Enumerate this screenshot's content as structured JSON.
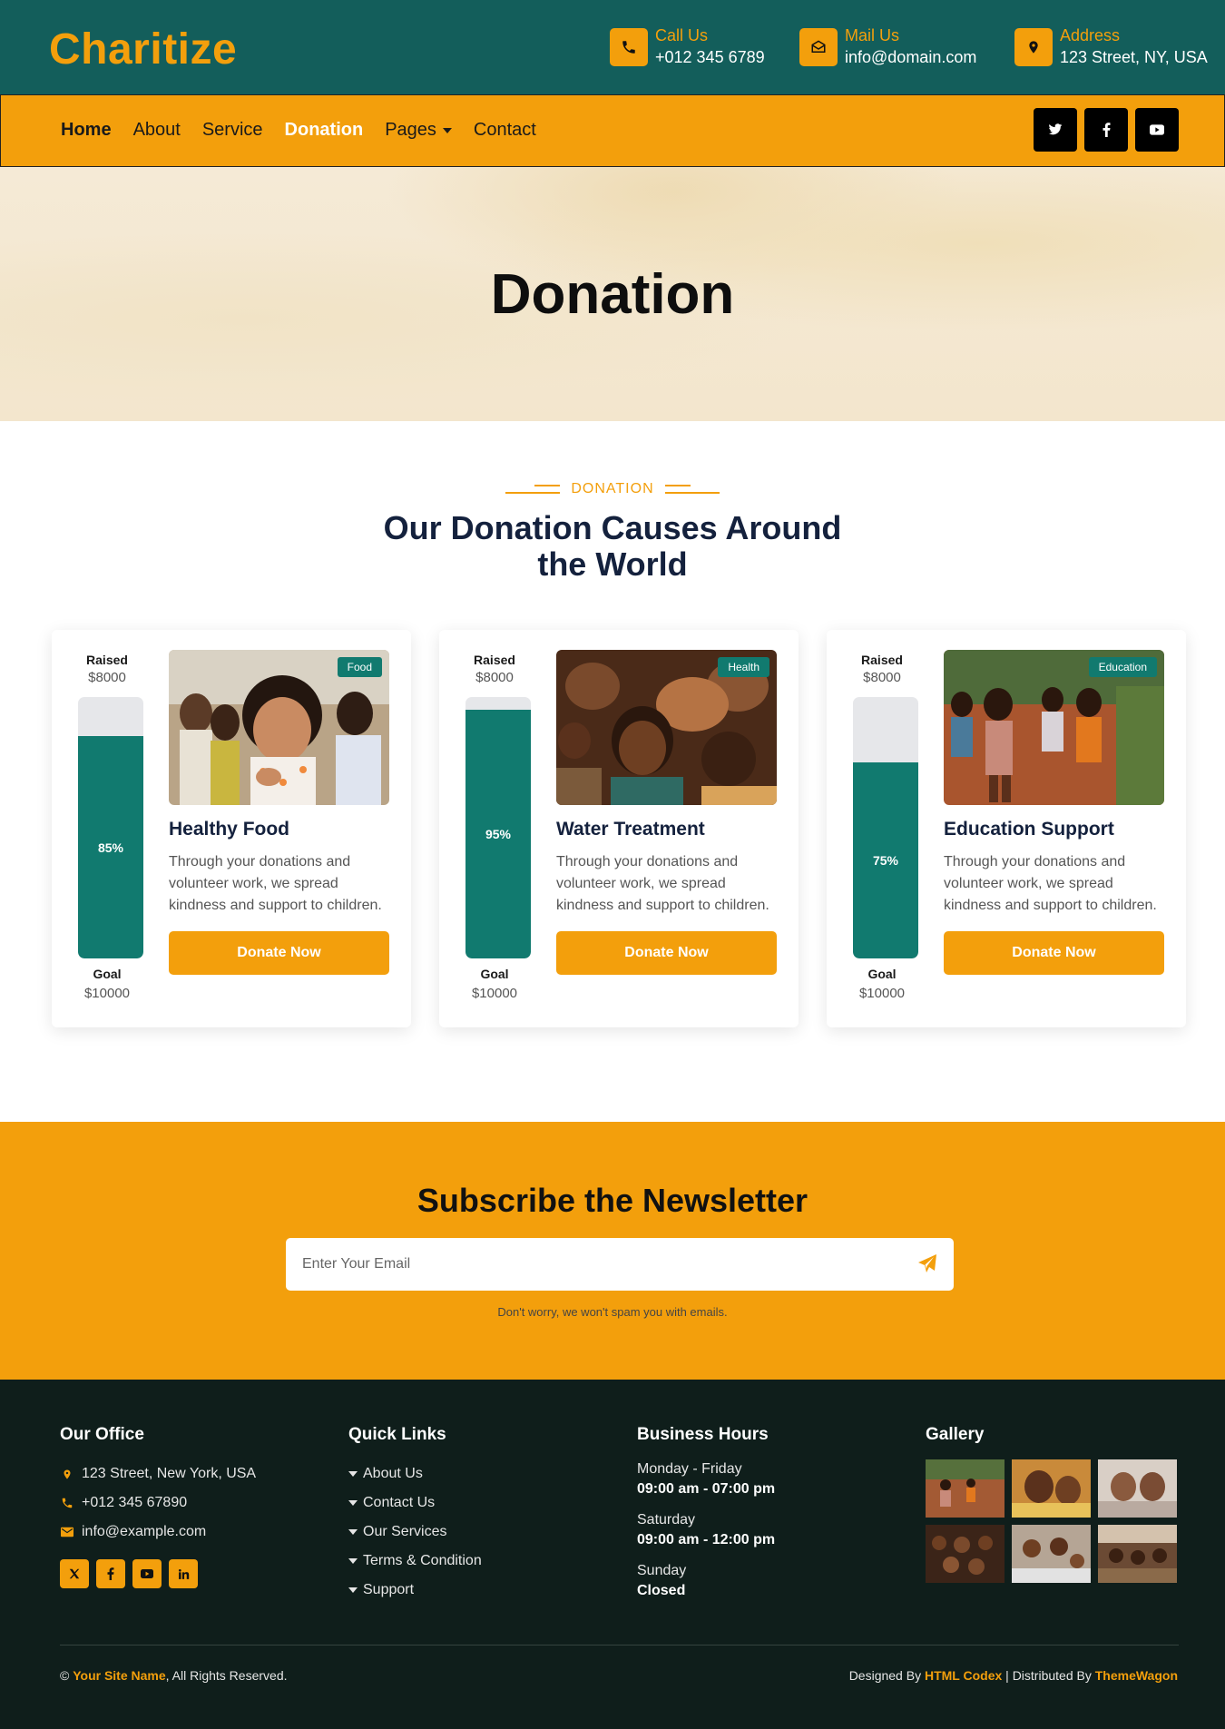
{
  "brand": {
    "logo": "Charitize",
    "accent": "#f39f0c",
    "primary": "#135e5b",
    "teal": "#117a6f"
  },
  "topbar": {
    "call": {
      "label": "Call Us",
      "value": "+012 345 6789",
      "icon": "phone-icon"
    },
    "mail": {
      "label": "Mail Us",
      "value": "info@domain.com",
      "icon": "envelope-icon"
    },
    "address": {
      "label": "Address",
      "value": "123 Street, NY, USA",
      "icon": "map-pin-icon"
    }
  },
  "nav": {
    "items": [
      "Home",
      "About",
      "Service",
      "Donation",
      "Pages",
      "Contact"
    ],
    "active": "Donation",
    "socials": [
      "twitter-icon",
      "facebook-icon",
      "youtube-icon"
    ]
  },
  "hero": {
    "title": "Donation"
  },
  "causes": {
    "eyebrow": "DONATION",
    "title_line1": "Our Donation Causes Around",
    "title_line2": "the World",
    "raised_label": "Raised",
    "goal_label": "Goal",
    "button": "Donate Now",
    "cards": [
      {
        "tag": "Food",
        "title": "Healthy Food",
        "desc": "Through your donations and volunteer work, we spread kindness and support to children.",
        "raised": "$8000",
        "goal": "$10000",
        "percent_label": "85%",
        "percent": 0.85
      },
      {
        "tag": "Health",
        "title": "Water Treatment",
        "desc": "Through your donations and volunteer work, we spread kindness and support to children.",
        "raised": "$8000",
        "goal": "$10000",
        "percent_label": "95%",
        "percent": 0.95
      },
      {
        "tag": "Education",
        "title": "Education Support",
        "desc": "Through your donations and volunteer work, we spread kindness and support to children.",
        "raised": "$8000",
        "goal": "$10000",
        "percent_label": "75%",
        "percent": 0.75
      }
    ]
  },
  "newsletter": {
    "title": "Subscribe the Newsletter",
    "placeholder": "Enter Your Email",
    "note": "Don't worry, we won't spam you with emails."
  },
  "footer": {
    "office": {
      "heading": "Our Office",
      "address": "123 Street, New York, USA",
      "phone": "+012 345 67890",
      "email": "info@example.com"
    },
    "quick": {
      "heading": "Quick Links",
      "links": [
        "About Us",
        "Contact Us",
        "Our Services",
        "Terms & Condition",
        "Support"
      ]
    },
    "hours": {
      "heading": "Business Hours",
      "rows": [
        {
          "day": "Monday - Friday",
          "time": "09:00 am - 07:00 pm"
        },
        {
          "day": "Saturday",
          "time": "09:00 am - 12:00 pm"
        },
        {
          "day": "Sunday",
          "time": "Closed"
        }
      ]
    },
    "gallery": {
      "heading": "Gallery"
    },
    "copyright_prefix": "©",
    "site_name": "Your Site Name",
    "rights": ", All Rights Reserved.",
    "designed_by": "Designed By",
    "codex": "HTML Codex",
    "distributed_by": "| Distributed By",
    "themewagon": "ThemeWagon"
  }
}
